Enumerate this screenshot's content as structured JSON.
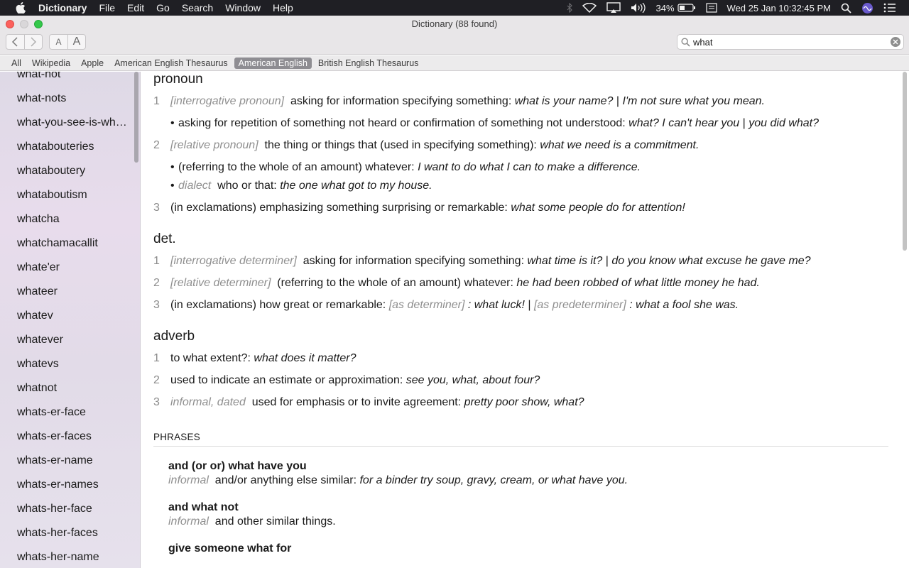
{
  "menubar": {
    "app_name": "Dictionary",
    "menus": [
      "File",
      "Edit",
      "Go",
      "Search",
      "Window",
      "Help"
    ],
    "battery": "34%",
    "clock": "Wed 25 Jan  10:32:45 PM"
  },
  "window": {
    "title": "Dictionary (88 found)"
  },
  "toolbar": {
    "font_small": "A",
    "font_large": "A",
    "search_value": "what"
  },
  "sources": {
    "active_index": 4,
    "items": [
      "All",
      "Wikipedia",
      "Apple",
      "American English Thesaurus",
      "American English",
      "British English Thesaurus"
    ]
  },
  "sidebar": {
    "items": [
      "what-not",
      "what-nots",
      "what-you-see-is-wh…",
      "whatabouteries",
      "whataboutery",
      "whataboutism",
      "whatcha",
      "whatchamacallit",
      "whate'er",
      "whateer",
      "whatev",
      "whatever",
      "whatevs",
      "whatnot",
      "whats-er-face",
      "whats-er-faces",
      "whats-er-name",
      "whats-er-names",
      "whats-her-face",
      "whats-her-faces",
      "whats-her-name"
    ]
  },
  "entry": {
    "pronoun": {
      "pos": "pronoun",
      "s1": {
        "num": "1",
        "label": "[interrogative pronoun]",
        "def": "asking for information specifying something:",
        "ex1": "what is your name?",
        "sep": "|",
        "ex2": "I'm not sure what you mean."
      },
      "s1a": {
        "bullet": "•",
        "def": "asking for repetition of something not heard or confirmation of something not understood:",
        "ex1": "what? I can't hear you",
        "sep": "|",
        "ex2": "you did what?"
      },
      "s2": {
        "num": "2",
        "label": "[relative pronoun]",
        "def": "the thing or things that (used in specifying something):",
        "ex1": "what we need is a commitment."
      },
      "s2a": {
        "bullet": "•",
        "def": "(referring to the whole of an amount) whatever:",
        "ex1": "I want to do what I can to make a difference."
      },
      "s2b": {
        "bullet": "•",
        "label": "dialect",
        "def": "who or that:",
        "ex1": "the one what got to my house."
      },
      "s3": {
        "num": "3",
        "def": "(in exclamations) emphasizing something surprising or remarkable:",
        "ex1": "what some people do for attention!"
      }
    },
    "det": {
      "pos": "det.",
      "s1": {
        "num": "1",
        "label": "[interrogative determiner]",
        "def": "asking for information specifying something:",
        "ex1": "what time is it?",
        "sep": "|",
        "ex2": "do you know what excuse he gave me?"
      },
      "s2": {
        "num": "2",
        "label": "[relative determiner]",
        "def": "(referring to the whole of an amount) whatever:",
        "ex1": "he had been robbed of what little money he had."
      },
      "s3": {
        "num": "3",
        "def": "(in exclamations) how great or remarkable:",
        "label1": "[as determiner]",
        "ex1": ": what luck!",
        "sep": "|",
        "label2": "[as predeterminer]",
        "ex2": ": what a fool she was."
      }
    },
    "adverb": {
      "pos": "adverb",
      "s1": {
        "num": "1",
        "def": "to what extent?:",
        "ex1": "what does it matter?"
      },
      "s2": {
        "num": "2",
        "def": "used to indicate an estimate or approximation:",
        "ex1": "see you, what, about four?"
      },
      "s3": {
        "num": "3",
        "label": "informal, dated",
        "def": "used for emphasis or to invite agreement:",
        "ex1": "pretty poor show, what?"
      }
    },
    "phrases": {
      "heading": "PHRASES",
      "p1": {
        "head": "and (or or) what have you",
        "label": "informal",
        "def": "and/or anything else similar:",
        "ex": "for a binder try soup, gravy, cream, or what have you."
      },
      "p2": {
        "head": "and what not",
        "label": "informal",
        "def": "and other similar things."
      },
      "p3": {
        "head": "give someone what for"
      }
    }
  },
  "colors": {
    "menubar_bg": "#1f1f24",
    "active_source_bg": "#8e8d92",
    "label_gray": "#8f8f8f"
  }
}
